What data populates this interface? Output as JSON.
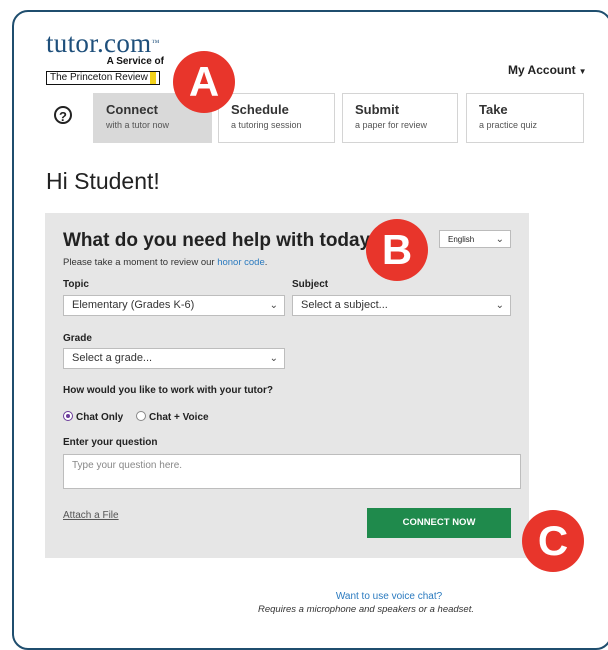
{
  "logo": {
    "name": "tutor.com",
    "tagline": "A Service of",
    "partner": "The Princeton Review"
  },
  "account": {
    "label": "My Account"
  },
  "tabs": [
    {
      "title": "Connect",
      "subtitle": "with a tutor now",
      "active": true
    },
    {
      "title": "Schedule",
      "subtitle": "a tutoring session",
      "active": false
    },
    {
      "title": "Submit",
      "subtitle": "a paper for review",
      "active": false
    },
    {
      "title": "Take",
      "subtitle": "a practice quiz",
      "active": false
    }
  ],
  "callouts": {
    "a": "A",
    "b": "B",
    "c": "C"
  },
  "greeting": "Hi Student!",
  "form": {
    "heading": "What do you need help with today?",
    "honor_prefix": "Please take a moment to review our ",
    "honor_link": "honor code",
    "honor_suffix": ".",
    "language": "English",
    "topic_label": "Topic",
    "topic_value": "Elementary (Grades K-6)",
    "subject_label": "Subject",
    "subject_value": "Select a subject...",
    "grade_label": "Grade",
    "grade_value": "Select a grade...",
    "work_question": "How would you like to work with your tutor?",
    "mode_chat": "Chat Only",
    "mode_voice": "Chat + Voice",
    "question_label": "Enter your question",
    "question_placeholder": "Type your question here.",
    "attach_label": "Attach a File",
    "connect_label": "CONNECT NOW"
  },
  "footer": {
    "voice_link": "Want to use voice chat?",
    "voice_note": "Requires a microphone and speakers or a headset."
  },
  "colors": {
    "brand_blue": "#1e4f7b",
    "callout_red": "#e8352b",
    "connect_green": "#1f8a4c",
    "link_blue": "#2a7abf"
  }
}
